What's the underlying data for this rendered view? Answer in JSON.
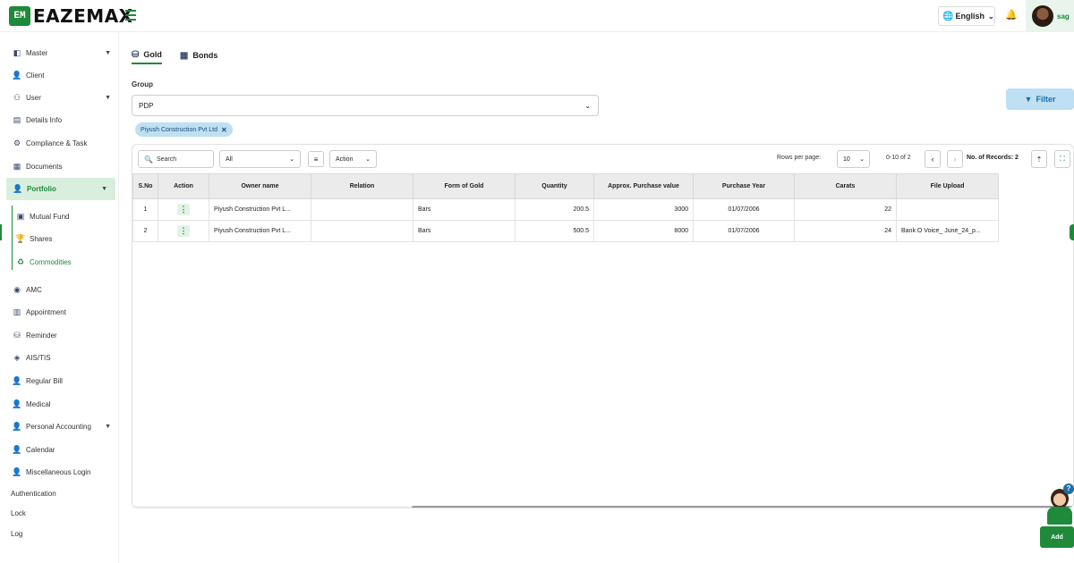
{
  "brand": {
    "logo_mark": "EM",
    "name": "EAZEMAX",
    "accent": "#1e8a3a"
  },
  "header": {
    "language": "English",
    "user_name": "sag",
    "icons": {
      "menu": "hamburger-icon",
      "globe": "globe-icon",
      "bell": "bell-icon"
    }
  },
  "sidebar": {
    "items": [
      {
        "label": "Master",
        "has_caret": true
      },
      {
        "label": "Client"
      },
      {
        "label": "User",
        "has_caret": true
      },
      {
        "label": "Details Info"
      },
      {
        "label": "Compliance & Task"
      },
      {
        "label": "Documents"
      },
      {
        "label": "Portfolio",
        "has_caret": true,
        "active": true
      },
      {
        "label": "Mutual Fund",
        "sub": true
      },
      {
        "label": "Shares",
        "sub": true
      },
      {
        "label": "Commodities",
        "sub": true,
        "selected": true
      },
      {
        "label": "AMC"
      },
      {
        "label": "Appointment"
      },
      {
        "label": "Reminder"
      },
      {
        "label": "AIS/TIS"
      },
      {
        "label": "Regular Bill"
      },
      {
        "label": "Medical"
      },
      {
        "label": "Personal Accounting",
        "has_caret": true
      },
      {
        "label": "Calendar"
      },
      {
        "label": "Miscellaneous Login"
      },
      {
        "label": "Authentication"
      },
      {
        "label": "Lock"
      },
      {
        "label": "Log"
      }
    ]
  },
  "tabs": [
    {
      "label": "Gold",
      "active": true
    },
    {
      "label": "Bonds",
      "active": false
    }
  ],
  "filters": {
    "group_label": "Group",
    "group_value": "PDP",
    "chip_label": "Piyush Construction Pvt Ltd",
    "filter_button": "Filter"
  },
  "toolbar": {
    "search_placeholder": "Search",
    "select_value": "All",
    "action_label": "Action",
    "rows_per_page_label": "Rows per page:",
    "rows_per_page": "10",
    "range": "0-10 of 2",
    "records": "No. of Records: 2"
  },
  "table": {
    "columns": [
      "S.No",
      "Action",
      "Owner name",
      "Relation",
      "Form of Gold",
      "Quantity",
      "Approx. Purchase value",
      "Purchase Year",
      "Carats",
      "File Upload"
    ],
    "rows": [
      {
        "sno": "1",
        "owner": "Piyush Construction Pvt L...",
        "relation": "",
        "form": "Bars",
        "quantity": "200.5",
        "value": "3000",
        "year": "01/07/2006",
        "carats": "22",
        "file": ""
      },
      {
        "sno": "2",
        "owner": "Piyush Construction Pvt L...",
        "relation": "",
        "form": "Bars",
        "quantity": "500.5",
        "value": "8000",
        "year": "01/07/2006",
        "carats": "24",
        "file": "Bank O Voice_ June_24_p..."
      }
    ]
  },
  "fab": {
    "help_glyph": "?",
    "add_label": "Add"
  }
}
